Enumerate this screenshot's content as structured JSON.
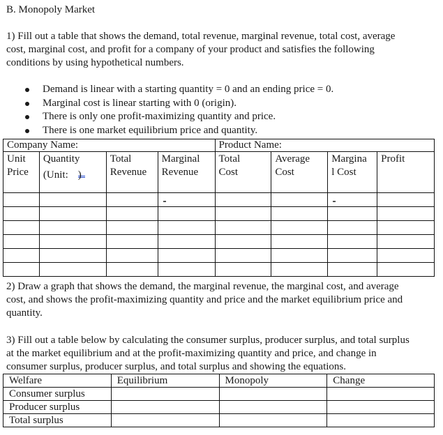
{
  "section_title": "B. Monopoly Market",
  "question1": {
    "text_line1": "1) Fill out a table that shows the demand, total revenue, marginal revenue, total cost, average",
    "text_line2": "cost, marginal cost, and profit for a company of your product and satisfies the following",
    "text_line3": "conditions by using hypothetical numbers.",
    "bullets": [
      "Demand is linear with a starting quantity = 0 and an ending price = 0.",
      "Marginal cost is linear starting with 0 (origin).",
      "There is only one profit-maximizing quantity and price.",
      "There is one market equilibrium price and quantity."
    ]
  },
  "table1": {
    "company_label": "Company Name:",
    "product_label": "Product Name:",
    "headers": [
      {
        "line1": "Unit",
        "line2": "Price"
      },
      {
        "line1": "Quantity",
        "line2": "(Unit:"
      },
      {
        "line1": "Total",
        "line2": "Revenue"
      },
      {
        "line1": "Marginal",
        "line2": "Revenue"
      },
      {
        "line1": "Total",
        "line2": "Cost"
      },
      {
        "line1": "Average",
        "line2": "Cost"
      },
      {
        "line1": "Margina",
        "line2": "l Cost"
      },
      {
        "line1": "Profit",
        "line2": ""
      }
    ],
    "unit_close": ")",
    "first_row_marks": {
      "marginal_revenue": "-",
      "marginal_cost": "-"
    },
    "empty_rows": 6
  },
  "question2": {
    "text_line1": "2) Draw a graph that shows the demand, the marginal revenue, the marginal cost, and average",
    "text_line2": "cost, and shows the profit-maximizing quantity and price and the market equilibrium price and",
    "text_line3": "quantity."
  },
  "question3": {
    "text_line1": "3) Fill out a table below by calculating the consumer surplus, producer surplus, and total surplus",
    "text_line2": "at the market equilibrium and at the profit-maximizing quantity and price, and change in",
    "text_line3": "consumer surplus, producer surplus, and total surplus and showing the equations."
  },
  "table2": {
    "headers": [
      "Welfare",
      "Equilibrium",
      "Monopoly",
      "Change"
    ],
    "rows": [
      "Consumer surplus",
      "Producer surplus",
      "Total surplus"
    ]
  }
}
